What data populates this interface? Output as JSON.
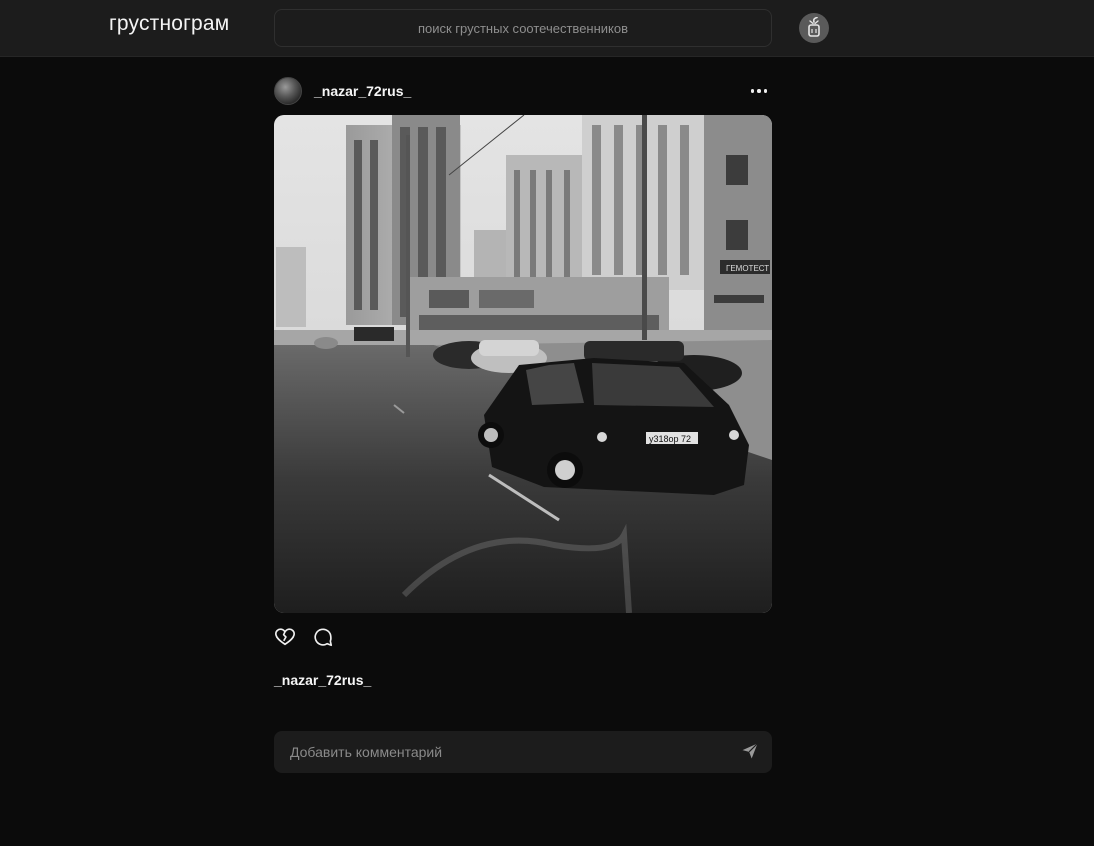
{
  "header": {
    "logo": "грустнограм",
    "search_placeholder": "поиск грустных соотечественников",
    "profile_icon": "apple-icon"
  },
  "post": {
    "username": "_nazar_72rus_",
    "more_icon": "more-dots-icon",
    "image": {
      "plate_text": "у318ор 72",
      "sign_text": "ГЕМОТЕСТ"
    },
    "actions": {
      "like_icon": "broken-heart-icon",
      "comment_icon": "comment-bubble-icon"
    },
    "caption_username": "_nazar_72rus_",
    "comment_placeholder": "Добавить комментарий",
    "send_icon": "send-icon"
  }
}
